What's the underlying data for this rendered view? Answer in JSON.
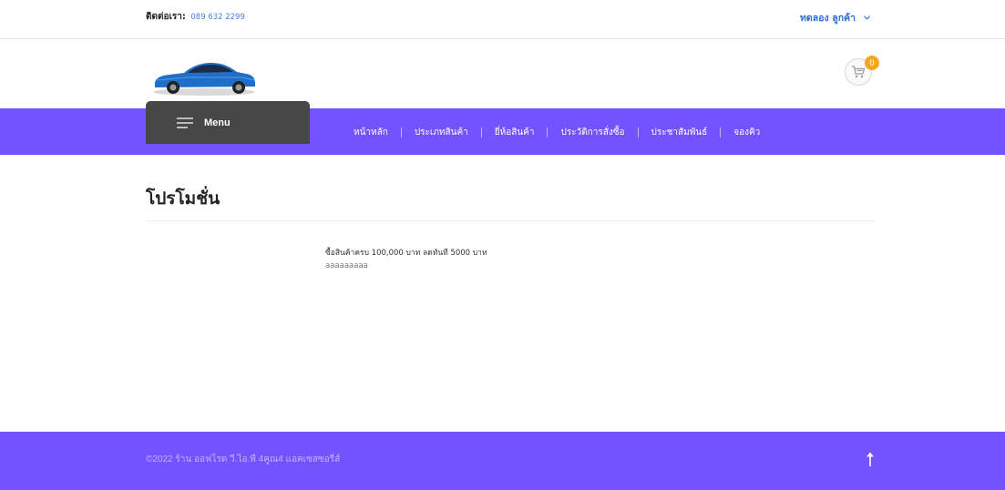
{
  "topbar": {
    "contact_label": "ติดต่อเรา:",
    "phone": "089 632 2299",
    "user_name": "ทดลอง ลูกค้า",
    "user_dropdown_icon": "chevron-down-icon"
  },
  "header": {
    "logo_icon": "car-logo-icon",
    "cart_icon": "shopping-cart-icon",
    "cart_count": "0"
  },
  "nav": {
    "menu_label": "Menu",
    "menu_icon": "hamburger-icon",
    "items": [
      {
        "label": "หน้าหลัก"
      },
      {
        "label": "ประเภทสินค้า"
      },
      {
        "label": "ยี่ห้อสินค้า"
      },
      {
        "label": "ประวัติการสั่งซื้อ"
      },
      {
        "label": "ประชาสัมพันธ์"
      },
      {
        "label": "จองคิว"
      }
    ]
  },
  "main": {
    "title": "โปรโมชั่น",
    "promotion": {
      "text": "ซื้อสินค้าครบ 100,000 บาท ลดทันที 5000 บาท",
      "detail": "aaaaaaaaa"
    }
  },
  "footer": {
    "copyright": "©2022 ร้าน ออฟโรด วี.ไอ.พี 4คูณ4 แอคเซสซอรี่ส์",
    "to_top_icon": "arrow-up-icon"
  },
  "colors": {
    "accent": "#7352ff",
    "menu_button": "#474747",
    "link": "#2d6fd4",
    "badge": "#f5a623"
  }
}
